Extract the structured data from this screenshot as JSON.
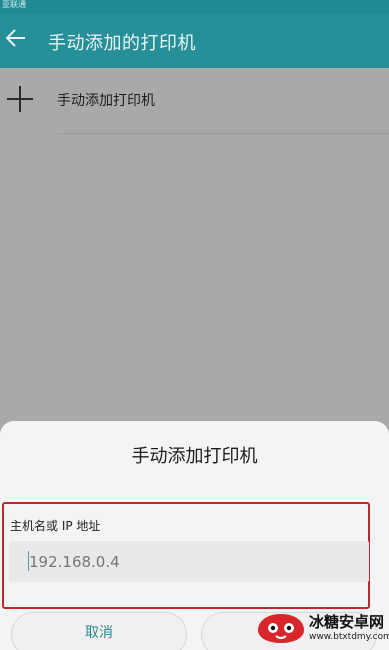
{
  "status_bar": {
    "carrier": "亚联通"
  },
  "app_bar": {
    "title": "手动添加的打印机"
  },
  "list": {
    "add_item_label": "手动添加打印机"
  },
  "dialog": {
    "title": "手动添加打印机",
    "field_label": "主机名或 IP 地址",
    "field_placeholder": "192.168.0.4",
    "field_value": "",
    "cancel_label": "取消"
  },
  "watermark": {
    "name": "冰糖安卓网",
    "url": "www.btxtdmy.com"
  },
  "colors": {
    "app_bar": "#268f98",
    "highlight_border": "#c0272d",
    "accent": "#2a8a93"
  }
}
